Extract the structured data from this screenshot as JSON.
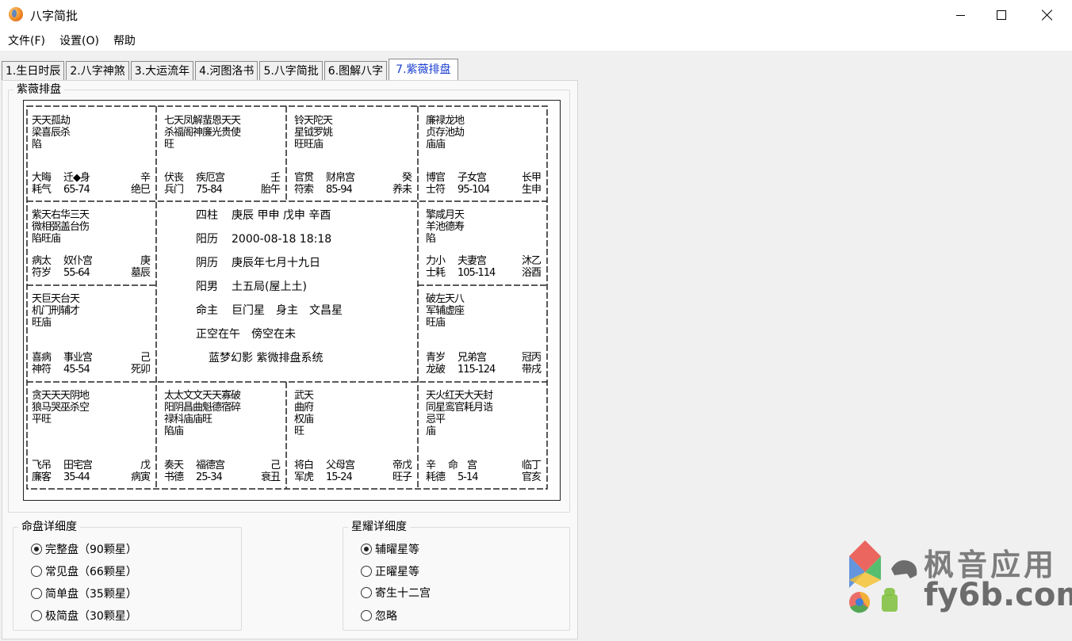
{
  "window": {
    "title": "八字简批"
  },
  "menu": [
    "文件(F)",
    "设置(O)",
    "帮助"
  ],
  "tabs": [
    {
      "label": "1.生日时辰"
    },
    {
      "label": "2.八字神煞"
    },
    {
      "label": "3.大运流年"
    },
    {
      "label": "4.河图洛书"
    },
    {
      "label": "5.八字简批"
    },
    {
      "label": "6.图解八字"
    },
    {
      "label": "7.紫薇排盘",
      "active": true
    }
  ],
  "chart_group": {
    "title": "紫薇排盘"
  },
  "palaces": {
    "c00": {
      "stars": "天天孤劫\n梁喜辰杀\n陷",
      "b1": [
        "大晦",
        "迁◆身",
        "辛"
      ],
      "b2": [
        "耗气",
        "65-74",
        "绝巳"
      ]
    },
    "c01": {
      "stars": "七天凤解蜚恩天天\n杀福阁神廉光贵使\n旺",
      "b1": [
        "伏丧",
        "疾厄宫",
        "壬"
      ],
      "b2": [
        "兵门",
        "75-84",
        "胎午"
      ]
    },
    "c02": {
      "stars": "铃天陀天\n星钺罗姚\n旺旺庙",
      "b1": [
        "官贯",
        "财帛宫",
        "癸"
      ],
      "b2": [
        "符索",
        "85-94",
        "养未"
      ]
    },
    "c03": {
      "stars": "廉禄龙地\n贞存池劫\n庙庙",
      "b1": [
        "博官",
        "子女宫",
        "长甲"
      ],
      "b2": [
        "士符",
        "95-104",
        "生申"
      ]
    },
    "c10": {
      "stars": "紫天右华三天\n微相弼盖台伤\n陷旺庙",
      "b1": [
        "病太",
        "奴仆宫",
        "庚"
      ],
      "b2": [
        "符岁",
        "55-64",
        "墓辰"
      ]
    },
    "c13": {
      "stars": "擎咸月天\n羊池德寿\n陷",
      "b1": [
        "力小",
        "夫妻宫",
        "沐乙"
      ],
      "b2": [
        "士耗",
        "105-114",
        "浴酉"
      ]
    },
    "c20": {
      "stars": "天巨天台天\n机门刑辅才\n旺庙",
      "b1": [
        "喜病",
        "事业宫",
        "己"
      ],
      "b2": [
        "神符",
        "45-54",
        "死卯"
      ]
    },
    "c23": {
      "stars": "破左天八\n军辅虚座\n旺庙",
      "b1": [
        "青岁",
        "兄弟宫",
        "冠丙"
      ],
      "b2": [
        "龙破",
        "115-124",
        "带戌"
      ]
    },
    "c30": {
      "stars": "贪天天天阴地\n狼马哭巫杀空\n平旺",
      "b1": [
        "飞吊",
        "田宅宫",
        "戊"
      ],
      "b2": [
        "廉客",
        "35-44",
        "病寅"
      ]
    },
    "c31": {
      "stars": "太太文文天天寡破\n阳阴昌曲魁德宿碎\n禄科庙庙旺\n陷庙",
      "b1": [
        "奏天",
        "福德宫",
        "己"
      ],
      "b2": [
        "书德",
        "25-34",
        "衰丑"
      ]
    },
    "c32": {
      "stars": "武天\n曲府\n权庙\n旺",
      "b1": [
        "将白",
        "父母宫",
        "帝戊"
      ],
      "b2": [
        "军虎",
        "15-24",
        "旺子"
      ]
    },
    "c33": {
      "stars": "天火红天大天封\n同星鸾官耗月诰\n忌平\n庙",
      "b1": [
        "辛",
        "命　宫",
        "临丁"
      ],
      "b2": [
        "耗德",
        "5-14",
        "官亥"
      ]
    }
  },
  "center": {
    "pillars_label": "四柱",
    "pillars_value": "庚辰 甲申 戊申 辛酉",
    "solar_label": "阳历",
    "solar_value": "2000-08-18 18:18",
    "lunar_label": "阴历",
    "lunar_value": "庚辰年七月十九日",
    "gender_label": "阳男",
    "gender_value": "土五局(屋上土)",
    "ming_label": "命主",
    "ming_value": "巨门星　身主　文昌星",
    "kong_value": "正空在午　傍空在未",
    "signature": "蓝梦幻影 紫微排盘系统"
  },
  "detail_group": {
    "title": "命盘详细度",
    "options": [
      {
        "label": "完整盘（90颗星）",
        "checked": true
      },
      {
        "label": "常见盘（66颗星）",
        "checked": false
      },
      {
        "label": "简单盘（35颗星）",
        "checked": false
      },
      {
        "label": "极简盘（30颗星）",
        "checked": false
      }
    ]
  },
  "star_group": {
    "title": "星耀详细度",
    "options": [
      {
        "label": "辅曜星等",
        "checked": true
      },
      {
        "label": "正曜星等",
        "checked": false
      },
      {
        "label": "寄生十二宫",
        "checked": false
      },
      {
        "label": "忽略",
        "checked": false
      }
    ]
  },
  "watermark": {
    "line1": "枫音应用",
    "line2": "fy6b.com"
  }
}
